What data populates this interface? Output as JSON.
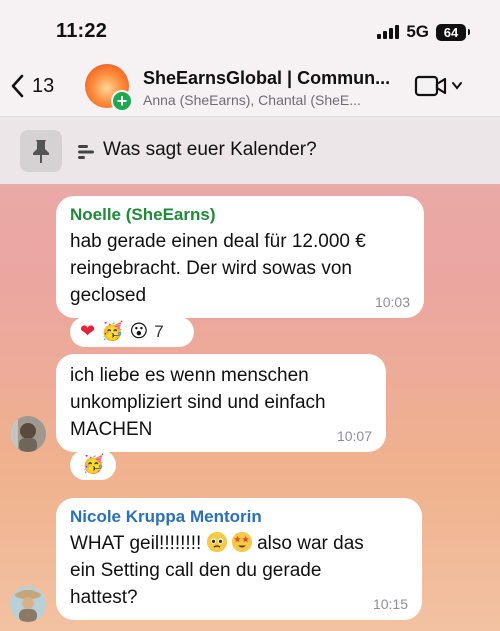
{
  "status_bar": {
    "time": "11:22",
    "network": "5G",
    "battery": "64"
  },
  "header": {
    "back_count": "13",
    "title": "SheEarnsGlobal | Commun...",
    "subtitle": "Anna (SheEarns), Chantal (SheE...",
    "avatar_badge": "+"
  },
  "pinned": {
    "text": "Was sagt euer Kalender?"
  },
  "messages": [
    {
      "sender": "Noelle (SheEarns)",
      "sender_color": "#1f8a3a",
      "text": "hab gerade einen deal für 12.000 €\nreingebracht. Der wird sowas von\ngeclosed",
      "time": "10:03",
      "reactions": [
        "❤",
        "🥳",
        "😮"
      ],
      "reaction_count": "7"
    },
    {
      "sender": "",
      "text": "ich liebe es wenn menschen\nunkompliziert sind und einfach\nMACHEN",
      "time": "10:07",
      "reactions": [
        "🥳"
      ]
    },
    {
      "sender": "Nicole Kruppa Mentorin",
      "sender_color": "#2a6fb8",
      "text_before": "WHAT geil!!!!!!!! ",
      "text_after": " also war das\nein Setting call den du gerade\nhattest?",
      "time": "10:15"
    }
  ],
  "colors": {
    "accent_green": "#1fa84f",
    "link_blue": "#2a6fb8"
  }
}
